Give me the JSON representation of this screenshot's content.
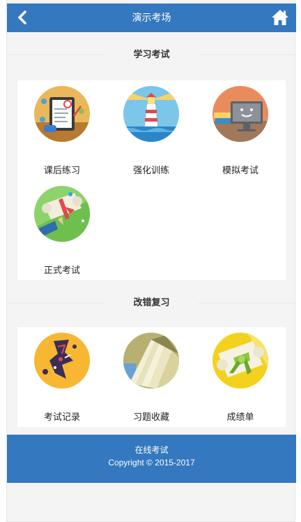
{
  "header": {
    "title": "演示考场",
    "back_icon": "chevron-left-icon",
    "home_icon": "home-icon"
  },
  "sections": [
    {
      "title": "学习考试",
      "items": [
        {
          "label": "课后练习",
          "icon": "exercise-sheet-icon"
        },
        {
          "label": "强化训练",
          "icon": "lighthouse-icon"
        },
        {
          "label": "模拟考试",
          "icon": "monitor-icon"
        },
        {
          "label": "正式考试",
          "icon": "diploma-icon"
        }
      ]
    },
    {
      "title": "改错复习",
      "items": [
        {
          "label": "考试记录",
          "icon": "record-icon"
        },
        {
          "label": "习题收藏",
          "icon": "book-pages-icon"
        },
        {
          "label": "成绩单",
          "icon": "certificate-scroll-icon"
        }
      ]
    }
  ],
  "footer": {
    "line1": "在线考试",
    "line2": "Copyright © 2015-2017"
  },
  "colors": {
    "primary": "#3478bf",
    "background": "#f4f4f4"
  }
}
